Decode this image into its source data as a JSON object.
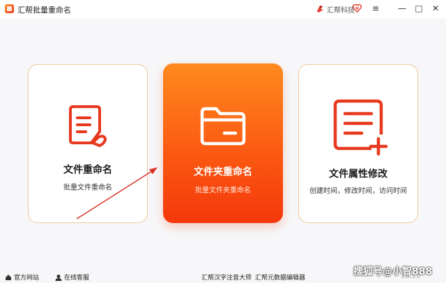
{
  "window": {
    "title": "汇帮批量重命名",
    "brand_name": "汇帮科技",
    "controls": {
      "menu": "≡",
      "minimize": "—",
      "maximize": "□",
      "close": "✕"
    }
  },
  "cards": [
    {
      "title": "文件重命名",
      "desc": "批量文件重命名",
      "icon": "file-document-icon"
    },
    {
      "title": "文件夹重命名",
      "desc": "批量文件夹重命名",
      "icon": "folder-icon"
    },
    {
      "title": "文件属性修改",
      "desc": "创建时间，修改时间，访问时间",
      "icon": "list-add-icon"
    }
  ],
  "footer": {
    "official_site": "官方网站",
    "online_service": "在线客服",
    "link_pinyin": "汇帮汉字注音大师",
    "link_metadata": "汇帮元数据编辑器",
    "version": "3.0.3.0"
  },
  "watermark": "搜狐号@小智888",
  "colors": {
    "accent_orange": "#fb5a12",
    "icon_red": "#e8391f",
    "card_border": "#f1c79a"
  }
}
